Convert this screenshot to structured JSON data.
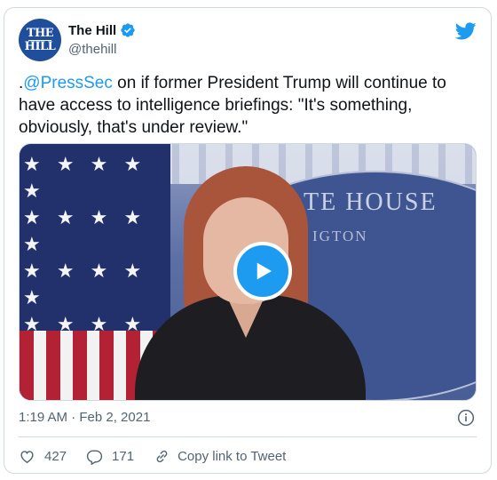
{
  "author": {
    "display_name": "The Hill",
    "handle": "@thehill",
    "avatar_line1": "THE",
    "avatar_line2": "HILL",
    "verified": true
  },
  "tweet": {
    "prefix": ".",
    "mention": "@PressSec",
    "text": " on if former President Trump will continue to have access to intelligence briefings: \"It's something, obviously, that's under review.\""
  },
  "media": {
    "type": "video",
    "backdrop_text": "TE HOUSE",
    "backdrop_subtext": "IGTON",
    "play_icon": "play-icon"
  },
  "meta": {
    "timestamp": "1:19 AM · Feb 2, 2021"
  },
  "actions": {
    "likes": "427",
    "replies": "171",
    "copy_link_label": "Copy link to Tweet"
  },
  "colors": {
    "accent": "#1d9bf0",
    "text": "#0f1419",
    "muted": "#536471",
    "border": "#cfd9de"
  }
}
